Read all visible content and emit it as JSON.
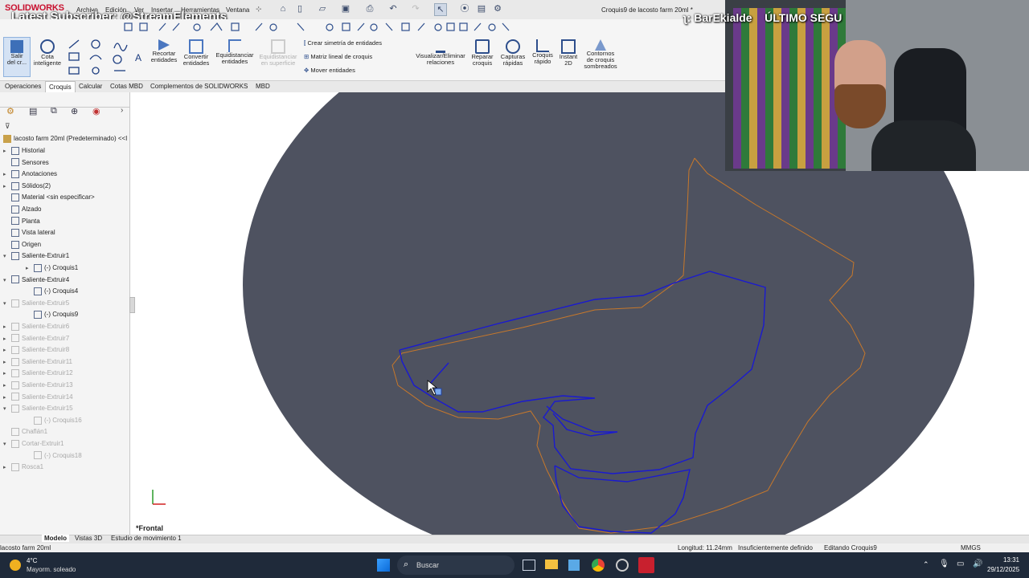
{
  "app": {
    "logo": "SOLIDWORKS",
    "document_title": "Croquis9 de lacosto farm 20ml *",
    "menu": [
      "Archivo",
      "Edición",
      "Ver",
      "Insertar",
      "Herramientas",
      "Ventana"
    ]
  },
  "stream": {
    "latest_subscriber": "Latest Subscriber: @StreamElements",
    "ticker": "ʅ: BarEkialde    ÚLTIMO SEGU"
  },
  "ribbon": {
    "buttons": [
      {
        "label": "Salir\ndel cr...",
        "icon": "exit-sketch-icon"
      },
      {
        "label": "Cota\ninteligente",
        "icon": "smart-dimension-icon"
      },
      {
        "label": "Recortar\nentidades",
        "icon": "trim-icon"
      },
      {
        "label": "Convertir\nentidades",
        "icon": "convert-icon"
      },
      {
        "label": "Equidistanciar\nentidades",
        "icon": "offset-icon"
      },
      {
        "label": "Equidistanciar\nen superficie",
        "icon": "offset-surface-icon",
        "disabled": true
      },
      {
        "label": "Visualizar/Eliminar\nrelaciones",
        "icon": "relations-icon"
      },
      {
        "label": "Reparar\ncroquis",
        "icon": "repair-icon"
      },
      {
        "label": "Capturas\nrápidas",
        "icon": "snaps-icon"
      },
      {
        "label": "Croquis\nrápido",
        "icon": "rapid-sketch-icon"
      },
      {
        "label": "Instant\n2D",
        "icon": "instant2d-icon"
      },
      {
        "label": "Contornos\nde croquis\nsombreados",
        "icon": "shaded-contours-icon"
      }
    ],
    "list_buttons": [
      "Crear simetría de entidades",
      "Matriz lineal de croquis",
      "Mover entidades"
    ]
  },
  "tabs": [
    "Operaciones",
    "Croquis",
    "Calcular",
    "Cotas MBD",
    "Complementos de SOLIDWORKS",
    "MBD"
  ],
  "active_tab": "Croquis",
  "tree": {
    "root": "lacosto farm 20ml (Predeterminado) <<I",
    "items": [
      {
        "label": "Historial",
        "dim": false,
        "level": 0,
        "exp": "▸"
      },
      {
        "label": "Sensores",
        "dim": false,
        "level": 0,
        "exp": ""
      },
      {
        "label": "Anotaciones",
        "dim": false,
        "level": 0,
        "exp": "▸"
      },
      {
        "label": "Sólidos(2)",
        "dim": false,
        "level": 0,
        "exp": "▸"
      },
      {
        "label": "Material <sin especificar>",
        "dim": false,
        "level": 0,
        "exp": ""
      },
      {
        "label": "Alzado",
        "dim": false,
        "level": 0,
        "exp": ""
      },
      {
        "label": "Planta",
        "dim": false,
        "level": 0,
        "exp": ""
      },
      {
        "label": "Vista lateral",
        "dim": false,
        "level": 0,
        "exp": ""
      },
      {
        "label": "Origen",
        "dim": false,
        "level": 0,
        "exp": ""
      },
      {
        "label": "Saliente-Extruir1",
        "dim": false,
        "level": 0,
        "exp": "▾"
      },
      {
        "label": "(-) Croquis1",
        "dim": false,
        "level": 1,
        "exp": "▸"
      },
      {
        "label": "Saliente-Extruir4",
        "dim": false,
        "level": 0,
        "exp": "▾"
      },
      {
        "label": "(-) Croquis4",
        "dim": false,
        "level": 1,
        "exp": ""
      },
      {
        "label": "Saliente-Extruir5",
        "dim": true,
        "level": 0,
        "exp": "▾"
      },
      {
        "label": "(-) Croquis9",
        "dim": false,
        "level": 1,
        "exp": ""
      },
      {
        "label": "Saliente-Extruir6",
        "dim": true,
        "level": 0,
        "exp": "▸"
      },
      {
        "label": "Saliente-Extruir7",
        "dim": true,
        "level": 0,
        "exp": "▸"
      },
      {
        "label": "Saliente-Extruir8",
        "dim": true,
        "level": 0,
        "exp": "▸"
      },
      {
        "label": "Saliente-Extruir11",
        "dim": true,
        "level": 0,
        "exp": "▸"
      },
      {
        "label": "Saliente-Extruir12",
        "dim": true,
        "level": 0,
        "exp": "▸"
      },
      {
        "label": "Saliente-Extruir13",
        "dim": true,
        "level": 0,
        "exp": "▸"
      },
      {
        "label": "Saliente-Extruir14",
        "dim": true,
        "level": 0,
        "exp": "▸"
      },
      {
        "label": "Saliente-Extruir15",
        "dim": true,
        "level": 0,
        "exp": "▾"
      },
      {
        "label": "(-) Croquis16",
        "dim": true,
        "level": 1,
        "exp": ""
      },
      {
        "label": "Chaflán1",
        "dim": true,
        "level": 0,
        "exp": ""
      },
      {
        "label": "Cortar-Extruir1",
        "dim": true,
        "level": 0,
        "exp": "▾"
      },
      {
        "label": "(-) Croquis18",
        "dim": true,
        "level": 1,
        "exp": ""
      },
      {
        "label": "Rosca1",
        "dim": true,
        "level": 0,
        "exp": "▸"
      }
    ]
  },
  "viewport": {
    "view_label": "*Frontal",
    "colors": {
      "body": "#4e5260",
      "sketch": "#1a1ad0",
      "edge": "#c8782a"
    }
  },
  "bottom_tabs": [
    "Modelo",
    "Vistas 3D",
    "Estudio de movimiento 1"
  ],
  "status": {
    "file": "lacosto farm 20ml",
    "length": "Longitud: 11.24mm",
    "definition": "Insuficientemente definido",
    "editing": "Editando Croquis9",
    "units": "MMGS"
  },
  "taskbar": {
    "weather_temp": "4°C",
    "weather_desc": "Mayorm. soleado",
    "search_placeholder": "Buscar",
    "time": "13:31",
    "date": "29/12/2025"
  }
}
